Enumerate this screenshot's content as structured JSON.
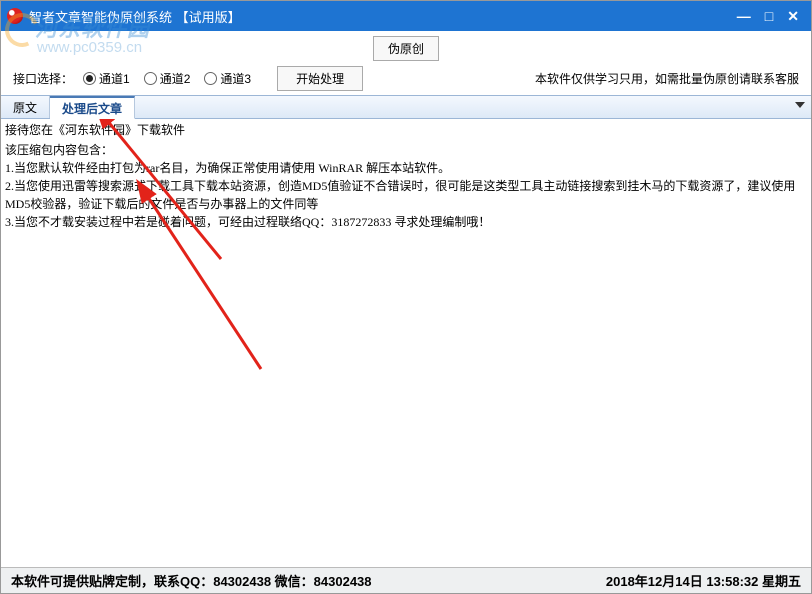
{
  "window": {
    "title": "智者文章智能伪原创系统 【试用版】"
  },
  "watermark": {
    "text": "河东软件园",
    "url": "www.pc0359.cn"
  },
  "toolbar": {
    "fake_original_btn": "伪原创",
    "interface_label": "接口选择：",
    "channel1": "通道1",
    "channel2": "通道2",
    "channel3": "通道3",
    "start_btn": "开始处理",
    "notice": "本软件仅供学习只用，如需批量伪原创请联系客服"
  },
  "tabs": {
    "original": "原文",
    "processed": "处理后文章"
  },
  "content": {
    "greeting": "接待您在《河东软件园》下载软件",
    "intro": "该压缩包内容包含：",
    "item1": "1.当您默认软件经由打包为rar名目，为确保正常使用请使用 WinRAR 解压本站软件。",
    "item2": "2.当您使用迅雷等搜索源式下载工具下载本站资源，创造MD5值验证不合错误时，很可能是这类型工具主动链接搜索到挂木马的下载资源了，建议使用MD5校验器，验证下载后的文件是否与办事器上的文件同等",
    "item3": "3.当您不才载安装过程中若是碰着问题，可经由过程联络QQ：3187272833 寻求处理编制哦！"
  },
  "statusbar": {
    "contact": "本软件可提供贴牌定制，联系QQ：84302438 微信：84302438",
    "datetime": "2018年12月14日 13:58:32 星期五"
  }
}
